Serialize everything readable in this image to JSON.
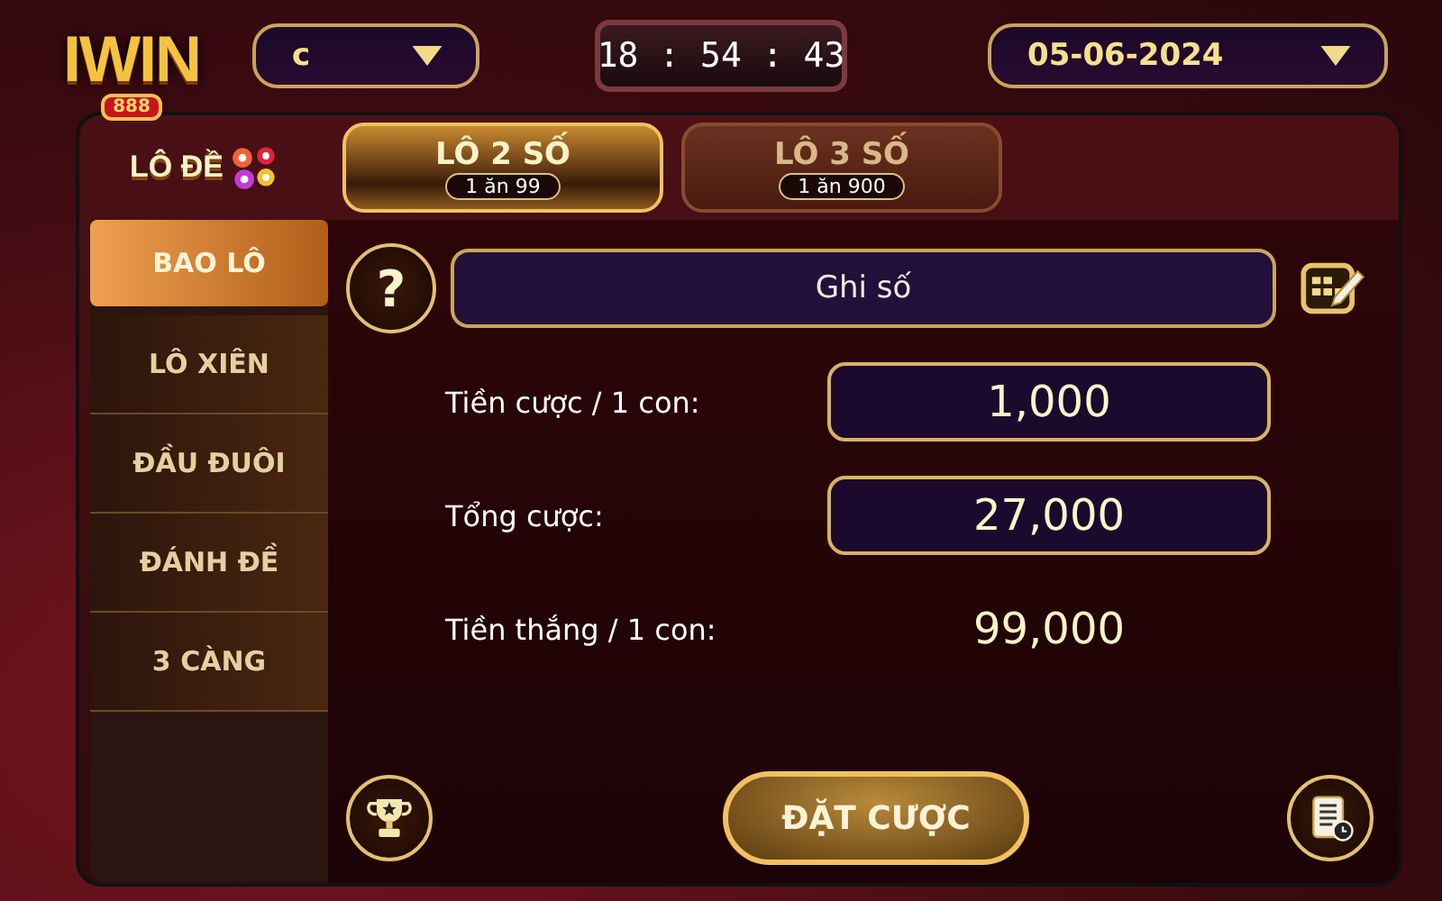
{
  "header": {
    "logo": {
      "name": "IWIN",
      "badge": "888"
    },
    "filter": {
      "value": "c"
    },
    "clock": "18 : 54 : 43",
    "date": {
      "value": "05-06-2024"
    }
  },
  "sidebar": {
    "title": "LÔ ĐỀ",
    "items": [
      {
        "label": "BAO LÔ",
        "selected": true
      },
      {
        "label": "LÔ XIÊN",
        "selected": false
      },
      {
        "label": "ĐẦU ĐUÔI",
        "selected": false
      },
      {
        "label": "ĐÁNH ĐỀ",
        "selected": false
      },
      {
        "label": "3 CÀNG",
        "selected": false
      }
    ]
  },
  "tabs": [
    {
      "label": "LÔ 2 SỐ",
      "rate": "1 ăn 99",
      "selected": true
    },
    {
      "label": "LÔ 3 SỐ",
      "rate": "1 ăn 900",
      "selected": false
    }
  ],
  "help": "?",
  "number_field": {
    "placeholder": "Ghi số"
  },
  "rows": [
    {
      "kind": "field",
      "label": "Tiền cược / 1 con:",
      "value": "1,000"
    },
    {
      "kind": "field",
      "label": "Tổng cược:",
      "value": "27,000"
    },
    {
      "kind": "text",
      "label": "Tiền thắng / 1 con:",
      "value": "99,000"
    }
  ],
  "submit": "ĐẶT CƯỢC"
}
